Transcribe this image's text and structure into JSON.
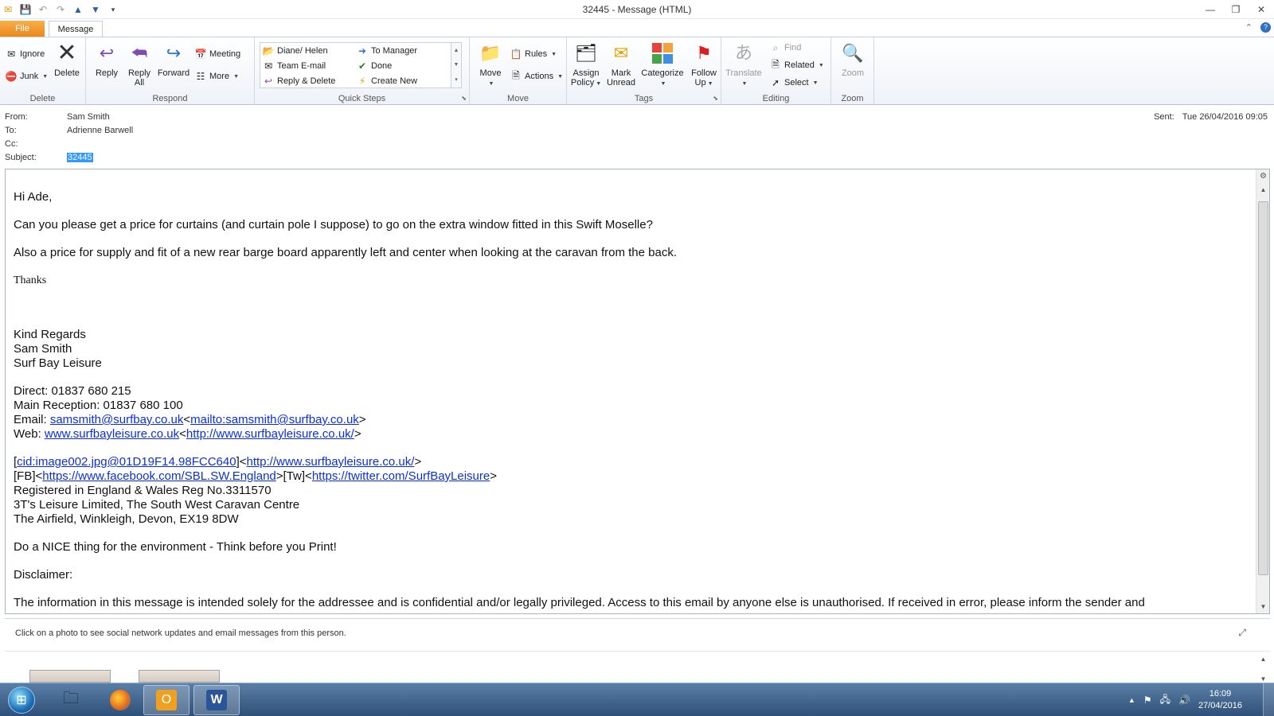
{
  "window": {
    "title": "32445  -  Message (HTML)"
  },
  "tabs": {
    "file": "File",
    "message": "Message"
  },
  "ribbon": {
    "delete_group": {
      "label": "Delete",
      "ignore": "Ignore",
      "junk": "Junk",
      "delete": "Delete"
    },
    "respond_group": {
      "label": "Respond",
      "reply": "Reply",
      "reply_all_1": "Reply",
      "reply_all_2": "All",
      "forward": "Forward",
      "meeting": "Meeting",
      "more": "More"
    },
    "quicksteps_group": {
      "label": "Quick Steps",
      "items": [
        "Diane/ Helen",
        "Team E-mail",
        "Reply & Delete",
        "To Manager",
        "Done",
        "Create New"
      ]
    },
    "move_group": {
      "label": "Move",
      "move": "Move",
      "rules": "Rules",
      "actions": "Actions"
    },
    "tags_group": {
      "label": "Tags",
      "assign_1": "Assign",
      "assign_2": "Policy",
      "mark_1": "Mark",
      "mark_2": "Unread",
      "categorize": "Categorize",
      "follow_1": "Follow",
      "follow_2": "Up"
    },
    "editing_group": {
      "label": "Editing",
      "translate": "Translate",
      "find": "Find",
      "related": "Related",
      "select": "Select"
    },
    "zoom_group": {
      "label": "Zoom",
      "zoom": "Zoom"
    }
  },
  "header": {
    "from_label": "From:",
    "from": "Sam Smith",
    "to_label": "To:",
    "to": "Adrienne Barwell",
    "cc_label": "Cc:",
    "cc": "",
    "subject_label": "Subject:",
    "subject": "32445",
    "sent_label": "Sent:",
    "sent": "Tue 26/04/2016 09:05"
  },
  "body": {
    "greeting": "Hi Ade,",
    "para1": "Can you please get a price for curtains (and curtain pole I suppose) to go on the extra window fitted in this Swift Moselle?",
    "para2": "Also a price for supply and fit of a new rear barge board apparently left and center when looking at the caravan from the back.",
    "thanks": "Thanks",
    "sig_regards": "Kind Regards",
    "sig_name": "Sam Smith",
    "sig_company": "Surf Bay Leisure",
    "direct": "Direct:  01837 680 215",
    "main_reception": "Main Reception:  01837 680 100",
    "email_label": "Email: ",
    "email_link": "samsmith@surfbay.co.uk",
    "email_mailto": "mailto:samsmith@surfbay.co.uk",
    "web_label": "Web: ",
    "web_link": "www.surfbayleisure.co.uk",
    "web_url": "http://www.surfbayleisure.co.uk/",
    "cid_link": "cid:image002.jpg@01D19F14.98FCC640",
    "cid_url": "http://www.surfbayleisure.co.uk/",
    "fb_label": "[FB]",
    "fb_url": "https://www.facebook.com/SBL.SW.England",
    "tw_label": "[Tw]",
    "tw_url": "https://twitter.com/SurfBayLeisure",
    "reg": "Registered in England & Wales Reg No.3311570",
    "company_full": "3T's Leisure Limited, The South West Caravan Centre",
    "address": "The Airfield, Winkleigh, Devon, EX19 8DW",
    "environment": "Do a NICE thing for the environment - Think before you Print!",
    "disclaimer": "Disclaimer:",
    "disclaimer_text": "The information in this message is intended solely for the addressee and is confidential and/or legally privileged. Access to this email by anyone else is unauthorised. If received in error, please inform the sender and"
  },
  "people_pane": {
    "hint": "Click on a photo to see social network updates and email messages from this person."
  },
  "taskbar": {
    "time": "16:09",
    "date": "27/04/2016"
  }
}
